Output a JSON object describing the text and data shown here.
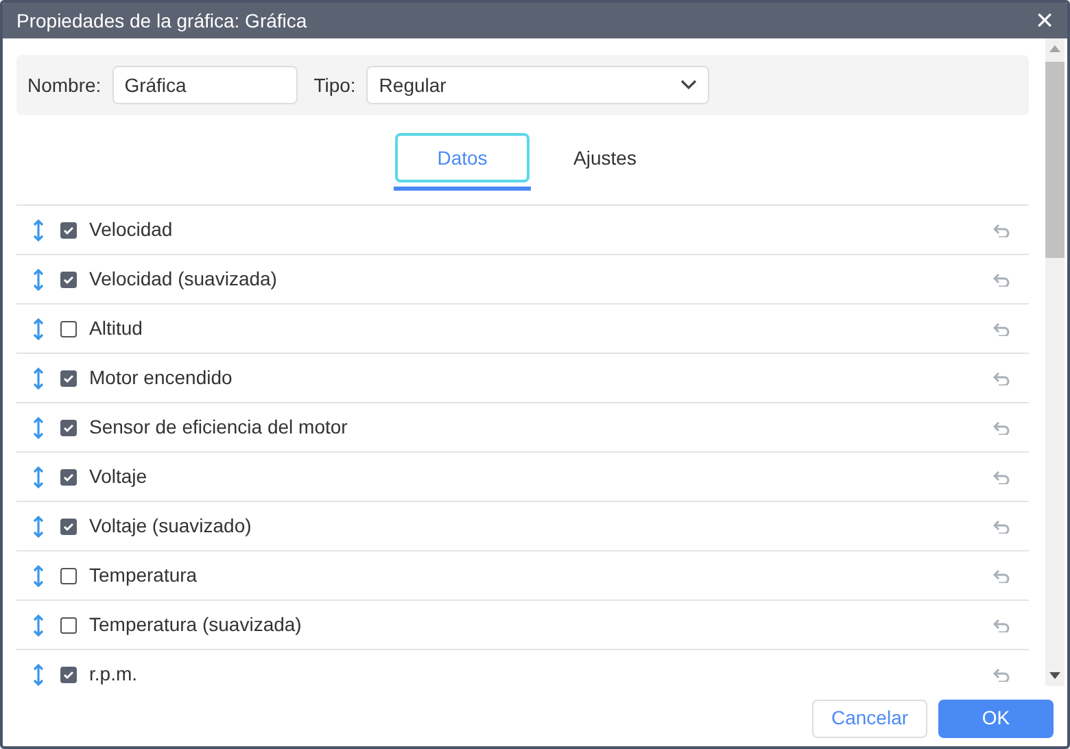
{
  "window": {
    "title": "Propiedades de la gráfica: Gráfica",
    "close": "×"
  },
  "form": {
    "name_label": "Nombre:",
    "name_value": "Gráfica",
    "type_label": "Tipo:",
    "type_value": "Regular"
  },
  "tabs": [
    {
      "label": "Datos",
      "selected": true
    },
    {
      "label": "Ajustes",
      "selected": false
    }
  ],
  "rows": [
    {
      "label": "Velocidad",
      "checked": true
    },
    {
      "label": "Velocidad (suavizada)",
      "checked": true
    },
    {
      "label": "Altitud",
      "checked": false
    },
    {
      "label": "Motor encendido",
      "checked": true
    },
    {
      "label": "Sensor de eficiencia del motor",
      "checked": true
    },
    {
      "label": "Voltaje",
      "checked": true
    },
    {
      "label": "Voltaje (suavizado)",
      "checked": true
    },
    {
      "label": "Temperatura",
      "checked": false
    },
    {
      "label": "Temperatura (suavizada)",
      "checked": false
    },
    {
      "label": "r.p.m.",
      "checked": true
    }
  ],
  "buttons": [
    {
      "label": "Cancelar",
      "kind": "secondary"
    },
    {
      "label": "OK",
      "kind": "primary"
    }
  ]
}
